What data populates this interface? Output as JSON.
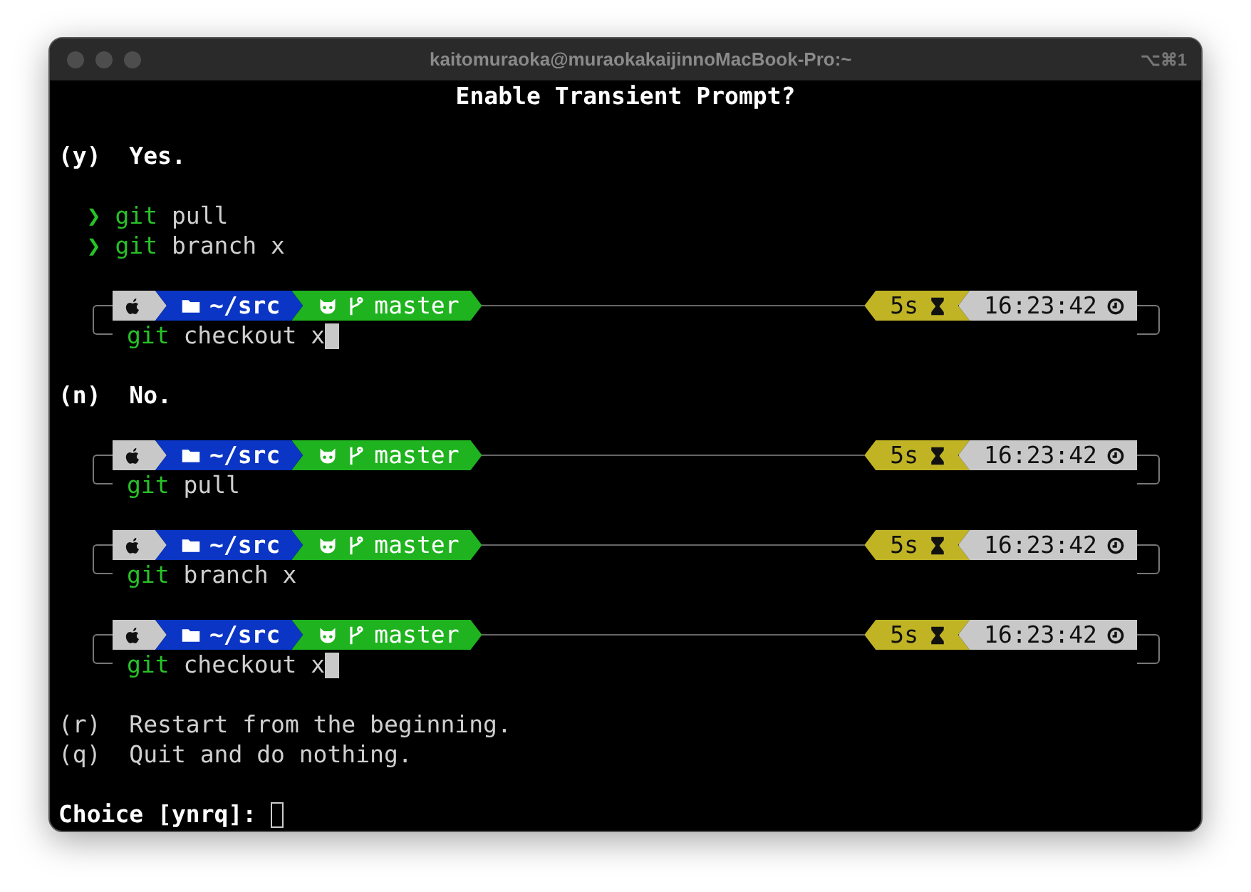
{
  "window": {
    "title": "kaitomuraoka@muraokakaijinnoMacBook-Pro:~",
    "shortcut": "⌥⌘1"
  },
  "lines": [
    {
      "kind": "heading",
      "text": "Enable Transient Prompt?"
    },
    {
      "kind": "blank"
    },
    {
      "kind": "option",
      "key": "(y)",
      "label": "Yes.",
      "emphasized": true
    },
    {
      "kind": "blank"
    },
    {
      "kind": "transient",
      "symbol": "❯",
      "command": "git",
      "args": "pull"
    },
    {
      "kind": "transient",
      "symbol": "❯",
      "command": "git",
      "args": "branch x"
    },
    {
      "kind": "blank"
    },
    {
      "kind": "prompt",
      "command": "git",
      "args": "checkout x",
      "cursor": true,
      "segments": [
        {
          "kind": "os",
          "color": "#c8c8c8"
        },
        {
          "kind": "directory",
          "text": "~/src",
          "color": "#0b35c4"
        },
        {
          "kind": "git",
          "text": "master",
          "color": "#1fb31f"
        }
      ],
      "right": [
        {
          "kind": "duration",
          "text": "5s",
          "color": "#c0b425"
        },
        {
          "kind": "clock",
          "text": "16:23:42",
          "color": "#c8c8c8"
        }
      ]
    },
    {
      "kind": "blank"
    },
    {
      "kind": "option",
      "key": "(n)",
      "label": "No.",
      "emphasized": true
    },
    {
      "kind": "blank"
    },
    {
      "kind": "prompt",
      "command": "git",
      "args": "pull",
      "cursor": false,
      "segments": [
        {
          "kind": "os",
          "color": "#c8c8c8"
        },
        {
          "kind": "directory",
          "text": "~/src",
          "color": "#0b35c4"
        },
        {
          "kind": "git",
          "text": "master",
          "color": "#1fb31f"
        }
      ],
      "right": [
        {
          "kind": "duration",
          "text": "5s",
          "color": "#c0b425"
        },
        {
          "kind": "clock",
          "text": "16:23:42",
          "color": "#c8c8c8"
        }
      ]
    },
    {
      "kind": "blank"
    },
    {
      "kind": "prompt",
      "command": "git",
      "args": "branch x",
      "cursor": false,
      "segments": [
        {
          "kind": "os",
          "color": "#c8c8c8"
        },
        {
          "kind": "directory",
          "text": "~/src",
          "color": "#0b35c4"
        },
        {
          "kind": "git",
          "text": "master",
          "color": "#1fb31f"
        }
      ],
      "right": [
        {
          "kind": "duration",
          "text": "5s",
          "color": "#c0b425"
        },
        {
          "kind": "clock",
          "text": "16:23:42",
          "color": "#c8c8c8"
        }
      ]
    },
    {
      "kind": "blank"
    },
    {
      "kind": "prompt",
      "command": "git",
      "args": "checkout x",
      "cursor": true,
      "segments": [
        {
          "kind": "os",
          "color": "#c8c8c8"
        },
        {
          "kind": "directory",
          "text": "~/src",
          "color": "#0b35c4"
        },
        {
          "kind": "git",
          "text": "master",
          "color": "#1fb31f"
        }
      ],
      "right": [
        {
          "kind": "duration",
          "text": "5s",
          "color": "#c0b425"
        },
        {
          "kind": "clock",
          "text": "16:23:42",
          "color": "#c8c8c8"
        }
      ]
    },
    {
      "kind": "blank"
    },
    {
      "kind": "option",
      "key": "(r)",
      "label": "Restart from the beginning.",
      "emphasized": false
    },
    {
      "kind": "option",
      "key": "(q)",
      "label": "Quit and do nothing.",
      "emphasized": false
    },
    {
      "kind": "blank"
    },
    {
      "kind": "input",
      "text": "Choice [ynrq]:",
      "cursor": true
    }
  ]
}
